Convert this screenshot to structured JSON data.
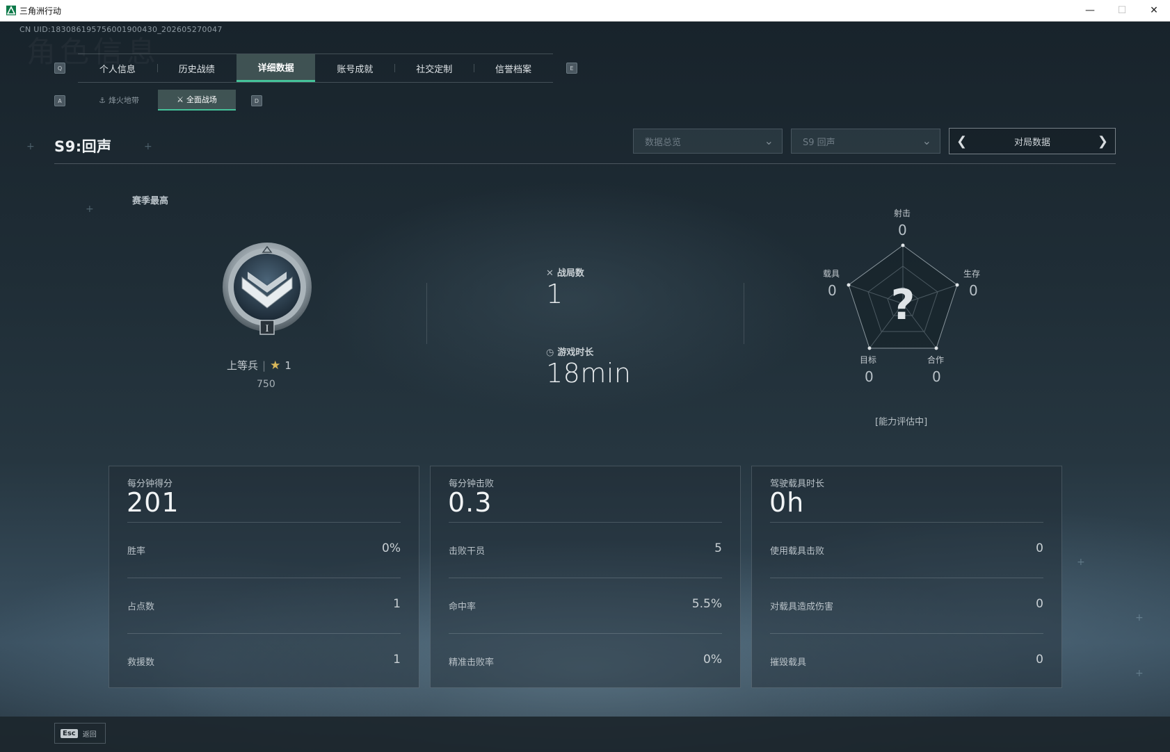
{
  "window": {
    "title": "三角洲行动",
    "minimize": "—",
    "maximize": "☐",
    "close": "✕"
  },
  "uid": "CN UID:1830861957560019004​30_202605270047",
  "bg_watermark": "角色信息",
  "tabs": {
    "left_key": "Q",
    "right_key": "E",
    "items": [
      "个人信息",
      "历史战绩",
      "详细数据",
      "账号成就",
      "社交定制",
      "信誉档案"
    ],
    "active_index": 2
  },
  "subtabs": {
    "left_key": "A",
    "right_key": "D",
    "items": [
      {
        "label": "烽火地带",
        "icon": "⚓"
      },
      {
        "label": "全面战场",
        "icon": "⚔"
      }
    ],
    "active_index": 1
  },
  "header": {
    "season_title": "S9:回声",
    "dropdown1": "数据总览",
    "dropdown2": "S9 回声",
    "pager_label": "对局数据"
  },
  "rank": {
    "season_best_label": "赛季最高",
    "name": "上等兵",
    "tier": "I",
    "stars": "1",
    "score": "750",
    "badge_numeral": "I"
  },
  "matches": {
    "label": "战局数",
    "value": "1"
  },
  "playtime": {
    "label": "游戏时长",
    "value": "18min"
  },
  "radar": {
    "center": "?",
    "assessment": "[能力评估中]",
    "axes": [
      {
        "label": "射击",
        "value": "0"
      },
      {
        "label": "生存",
        "value": "0"
      },
      {
        "label": "合作",
        "value": "0"
      },
      {
        "label": "目标",
        "value": "0"
      },
      {
        "label": "载具",
        "value": "0"
      }
    ]
  },
  "panels": [
    {
      "title": "每分钟得分",
      "big": "201",
      "rows": [
        {
          "label": "胜率",
          "value": "0%"
        },
        {
          "label": "占点数",
          "value": "1"
        },
        {
          "label": "救援数",
          "value": "1"
        }
      ]
    },
    {
      "title": "每分钟击败",
      "big": "0.3",
      "rows": [
        {
          "label": "击败干员",
          "value": "5"
        },
        {
          "label": "命中率",
          "value": "5.5%"
        },
        {
          "label": "精准击败率",
          "value": "0%"
        }
      ]
    },
    {
      "title": "驾驶载具时长",
      "big": "0h",
      "rows": [
        {
          "label": "使用载具击败",
          "value": "0"
        },
        {
          "label": "对载具造成伤害",
          "value": "0"
        },
        {
          "label": "摧毁载具",
          "value": "0"
        }
      ]
    }
  ],
  "footer": {
    "esc_key": "Esc",
    "back_label": "返回"
  },
  "colors": {
    "accent": "#45c29a",
    "star": "#d8b75a"
  }
}
